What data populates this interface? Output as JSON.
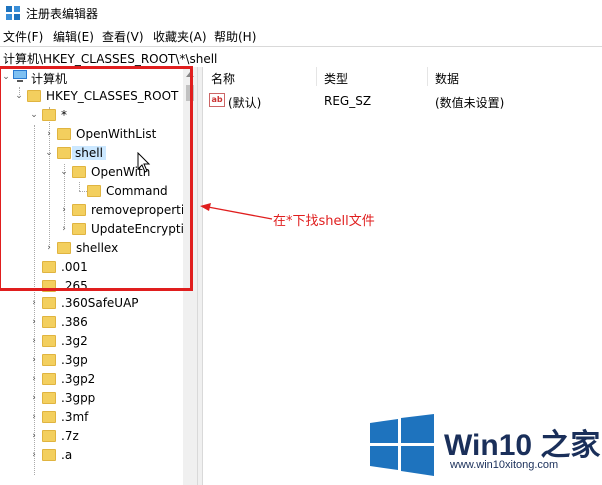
{
  "window": {
    "title": "注册表编辑器"
  },
  "menu": [
    "文件(F)",
    "编辑(E)",
    "查看(V)",
    "收藏夹(A)",
    "帮助(H)"
  ],
  "address": "计算机\\HKEY_CLASSES_ROOT\\*\\shell",
  "tree": {
    "computer": "计算机",
    "hkcr": "HKEY_CLASSES_ROOT",
    "star": "*",
    "openwithlist": "OpenWithList",
    "shell": "shell",
    "openwith": "OpenWith",
    "command": "Command",
    "removeproperties": "removepropertie",
    "updateencryption": "UpdateEncryptio",
    "shellex": "shellex",
    "ext_001": ".001",
    "ext_265": ".265",
    "ext_360": ".360SafeUAP",
    "ext_386": ".386",
    "ext_3g2": ".3g2",
    "ext_3gp": ".3gp",
    "ext_3gp2": ".3gp2",
    "ext_3gpp": ".3gpp",
    "ext_3mf": ".3mf",
    "ext_7z": ".7z",
    "ext_a": ".a"
  },
  "columns": {
    "name": "名称",
    "type": "类型",
    "data": "数据"
  },
  "value_row": {
    "name": "(默认)",
    "type": "REG_SZ",
    "data": "(数值未设置)"
  },
  "annotation": "在*下找shell文件",
  "logo": {
    "title": "Win10 之家",
    "url": "www.win10xitong.com"
  },
  "colors": {
    "highlight": "#cce8ff",
    "annotation": "#e01e1e",
    "folder": "#f3cf5e",
    "logo_blue": "#1e73be"
  }
}
